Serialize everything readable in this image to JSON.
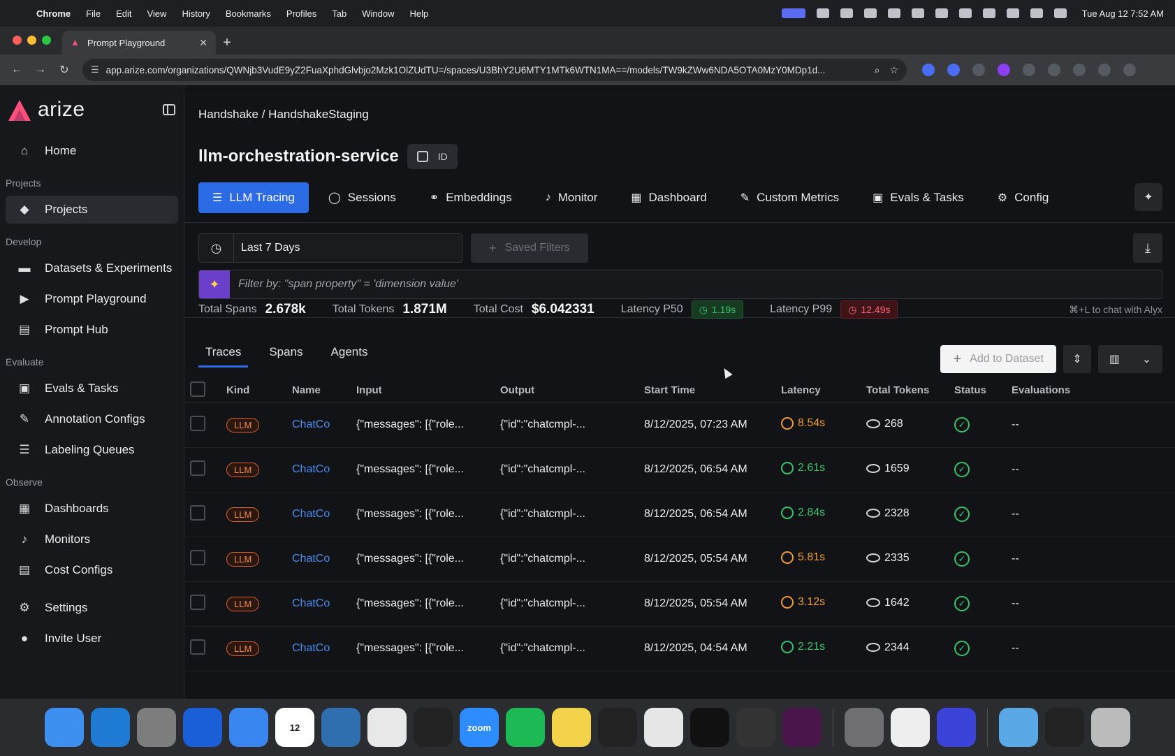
{
  "menubar": {
    "app": "Chrome",
    "items": [
      "File",
      "Edit",
      "View",
      "History",
      "Bookmarks",
      "Profiles",
      "Tab",
      "Window",
      "Help"
    ],
    "clock": "Tue Aug 12  7:52 AM"
  },
  "browser": {
    "tab_title": "Prompt Playground",
    "url": "app.arize.com/organizations/QWNjb3VudE9yZ2FuaXphdGlvbjo2Mzk1OlZUdTU=/spaces/U3BhY2U6MTY1MTk6WTN1MA==/models/TW9kZWw6NDA5OTA0MzY0MDp1d..."
  },
  "sidebar": {
    "brand": "arize",
    "items_top": [
      {
        "label": "Home",
        "icon": "home-icon"
      }
    ],
    "sections": [
      {
        "title": "Projects",
        "items": [
          {
            "label": "Projects",
            "icon": "cube-icon",
            "active": true
          }
        ]
      },
      {
        "title": "Develop",
        "items": [
          {
            "label": "Datasets & Experiments",
            "icon": "folder-icon"
          },
          {
            "label": "Prompt Playground",
            "icon": "play-icon"
          },
          {
            "label": "Prompt Hub",
            "icon": "archive-icon"
          }
        ]
      },
      {
        "title": "Evaluate",
        "items": [
          {
            "label": "Evals & Tasks",
            "icon": "lock-icon"
          },
          {
            "label": "Annotation Configs",
            "icon": "pencil-icon"
          },
          {
            "label": "Labeling Queues",
            "icon": "list-icon"
          }
        ]
      },
      {
        "title": "Observe",
        "items": [
          {
            "label": "Dashboards",
            "icon": "grid-icon"
          },
          {
            "label": "Monitors",
            "icon": "bell-icon"
          },
          {
            "label": "Cost Configs",
            "icon": "table-icon"
          }
        ]
      }
    ],
    "bottom": [
      {
        "label": "Settings",
        "icon": "gear-icon"
      },
      {
        "label": "Invite User",
        "icon": "user-icon"
      }
    ]
  },
  "header": {
    "breadcrumb": "Handshake / HandshakeStaging",
    "model_name": "llm-orchestration-service",
    "id_label": "ID"
  },
  "tabs": [
    "LLM Tracing",
    "Sessions",
    "Embeddings",
    "Monitor",
    "Dashboard",
    "Custom Metrics",
    "Evals & Tasks",
    "Config"
  ],
  "filters": {
    "time_range": "Last 7 Days",
    "saved_filters": "Saved Filters",
    "query_placeholder": "Filter by: \"span property\" = 'dimension value'"
  },
  "stats": {
    "total_spans_label": "Total Spans",
    "total_spans": "2.678k",
    "total_tokens_label": "Total Tokens",
    "total_tokens": "1.871M",
    "total_cost_label": "Total Cost",
    "total_cost": "$6.042331",
    "p50_label": "Latency P50",
    "p50": "1.19s",
    "p99_label": "Latency P99",
    "p99": "12.49s",
    "hint": "⌘+L to chat with Alyx"
  },
  "subtabs": [
    "Traces",
    "Spans",
    "Agents"
  ],
  "actions": {
    "add_to_dataset": "Add to Dataset"
  },
  "table": {
    "columns": [
      "Kind",
      "Name",
      "Input",
      "Output",
      "Start Time",
      "Latency",
      "Total Tokens",
      "Status",
      "Evaluations"
    ],
    "rows": [
      {
        "kind": "LLM",
        "name": "ChatCo",
        "input": "{\"messages\": [{\"role...",
        "output": "{\"id\":\"chatcmpl-...",
        "start": "8/12/2025, 07:23 AM",
        "latency": "8.54s",
        "latency_level": "orange",
        "tokens": "268",
        "eval": "--"
      },
      {
        "kind": "LLM",
        "name": "ChatCo",
        "input": "{\"messages\": [{\"role...",
        "output": "{\"id\":\"chatcmpl-...",
        "start": "8/12/2025, 06:54 AM",
        "latency": "2.61s",
        "latency_level": "green",
        "tokens": "1659",
        "eval": "--"
      },
      {
        "kind": "LLM",
        "name": "ChatCo",
        "input": "{\"messages\": [{\"role...",
        "output": "{\"id\":\"chatcmpl-...",
        "start": "8/12/2025, 06:54 AM",
        "latency": "2.84s",
        "latency_level": "green",
        "tokens": "2328",
        "eval": "--"
      },
      {
        "kind": "LLM",
        "name": "ChatCo",
        "input": "{\"messages\": [{\"role...",
        "output": "{\"id\":\"chatcmpl-...",
        "start": "8/12/2025, 05:54 AM",
        "latency": "5.81s",
        "latency_level": "orange",
        "tokens": "2335",
        "eval": "--"
      },
      {
        "kind": "LLM",
        "name": "ChatCo",
        "input": "{\"messages\": [{\"role...",
        "output": "{\"id\":\"chatcmpl-...",
        "start": "8/12/2025, 05:54 AM",
        "latency": "3.12s",
        "latency_level": "orange",
        "tokens": "1642",
        "eval": "--"
      },
      {
        "kind": "LLM",
        "name": "ChatCo",
        "input": "{\"messages\": [{\"role...",
        "output": "{\"id\":\"chatcmpl-...",
        "start": "8/12/2025, 04:54 AM",
        "latency": "2.21s",
        "latency_level": "green",
        "tokens": "2344",
        "eval": "--"
      }
    ]
  },
  "dock": {
    "apps": [
      "finder-icon",
      "vscode-icon",
      "launchpad-icon",
      "1password-icon",
      "mail-icon",
      "calendar-icon",
      "freeform-icon",
      "chrome-icon",
      "cursor-icon",
      "zoom-icon",
      "spotify-icon",
      "notes-icon",
      "terminal-icon",
      "textedit-icon",
      "capcut-icon",
      "butterfly-icon",
      "slack-icon",
      "settings-icon",
      "clock-icon",
      "github-icon",
      "folder-icon",
      "screen-icon",
      "trash-icon"
    ],
    "calendar_day": "12",
    "zoom_label": "zoom"
  },
  "colors": {
    "accent": "#2b6be6",
    "brand": "#ff4f7b",
    "ok": "#38c46c",
    "warn": "#f09a3a",
    "bad": "#ff6673"
  }
}
